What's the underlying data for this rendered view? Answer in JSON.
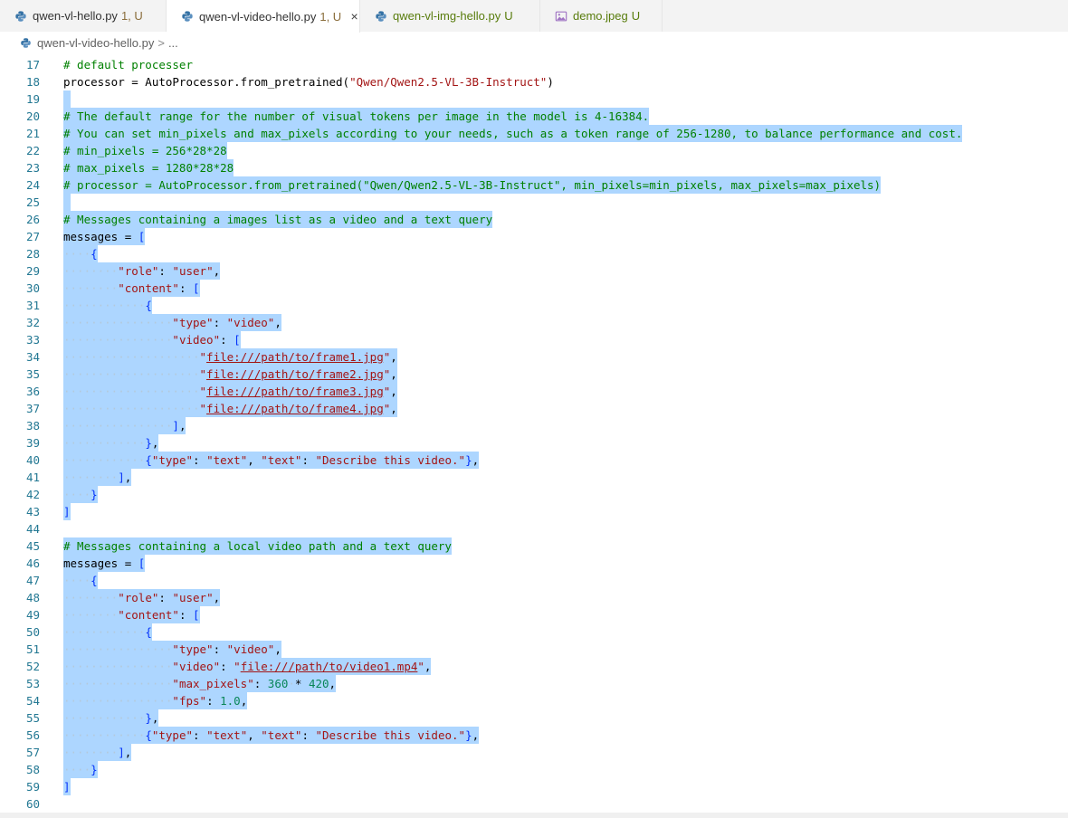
{
  "tabs": [
    {
      "name": "qwen-vl-hello.py",
      "badge": "1, U",
      "active": false,
      "kind": "python"
    },
    {
      "name": "qwen-vl-video-hello.py",
      "badge": "1, U",
      "active": true,
      "kind": "python",
      "close": "×"
    },
    {
      "name": "qwen-vl-img-hello.py",
      "badge": "U",
      "active": false,
      "kind": "python"
    },
    {
      "name": "demo.jpeg",
      "badge": "U",
      "active": false,
      "kind": "image"
    }
  ],
  "breadcrumb": {
    "file": "qwen-vl-video-hello.py",
    "separator": ">",
    "tail": "..."
  },
  "colors": {
    "comment": "#008000",
    "string": "#a31515",
    "number": "#098658",
    "bracket": "#0431fa",
    "selection": "#add6ff",
    "line_number": "#237893"
  },
  "lines": [
    {
      "n": "17",
      "sel": false,
      "segs": [
        [
          "c",
          "# default processer"
        ]
      ]
    },
    {
      "n": "18",
      "sel": false,
      "segs": [
        [
          "t",
          "processor = AutoProcessor.from_pretrained("
        ],
        [
          "s",
          "\"Qwen/Qwen2.5-VL-3B-Instruct\""
        ],
        [
          "t",
          ")"
        ]
      ]
    },
    {
      "n": "19",
      "sel": true,
      "segs": []
    },
    {
      "n": "20",
      "sel": true,
      "segs": [
        [
          "c",
          "# The default range for the number of visual tokens per image in the model is 4-16384."
        ]
      ]
    },
    {
      "n": "21",
      "sel": true,
      "segs": [
        [
          "c",
          "# You can set min_pixels and max_pixels according to your needs, such as a token range of 256-1280, to balance performance and cost."
        ]
      ]
    },
    {
      "n": "22",
      "sel": true,
      "segs": [
        [
          "c",
          "# min_pixels = 256*28*28"
        ]
      ]
    },
    {
      "n": "23",
      "sel": true,
      "segs": [
        [
          "c",
          "# max_pixels = 1280*28*28"
        ]
      ]
    },
    {
      "n": "24",
      "sel": true,
      "segs": [
        [
          "c",
          "# processor = AutoProcessor.from_pretrained(\"Qwen/Qwen2.5-VL-3B-Instruct\", min_pixels=min_pixels, max_pixels=max_pixels)"
        ]
      ]
    },
    {
      "n": "25",
      "sel": true,
      "segs": []
    },
    {
      "n": "26",
      "sel": true,
      "segs": [
        [
          "c",
          "# Messages containing a images list as a video and a text query"
        ]
      ]
    },
    {
      "n": "27",
      "sel": true,
      "segs": [
        [
          "t",
          "messages = "
        ],
        [
          "p",
          "["
        ]
      ]
    },
    {
      "n": "28",
      "sel": true,
      "segs": [
        [
          "t",
          "    "
        ],
        [
          "p",
          "{"
        ]
      ]
    },
    {
      "n": "29",
      "sel": true,
      "segs": [
        [
          "t",
          "        "
        ],
        [
          "s",
          "\"role\""
        ],
        [
          "t",
          ": "
        ],
        [
          "s",
          "\"user\""
        ],
        [
          "t",
          ","
        ]
      ]
    },
    {
      "n": "30",
      "sel": true,
      "segs": [
        [
          "t",
          "        "
        ],
        [
          "s",
          "\"content\""
        ],
        [
          "t",
          ": "
        ],
        [
          "p",
          "["
        ]
      ]
    },
    {
      "n": "31",
      "sel": true,
      "segs": [
        [
          "t",
          "            "
        ],
        [
          "p",
          "{"
        ]
      ]
    },
    {
      "n": "32",
      "sel": true,
      "segs": [
        [
          "t",
          "                "
        ],
        [
          "s",
          "\"type\""
        ],
        [
          "t",
          ": "
        ],
        [
          "s",
          "\"video\""
        ],
        [
          "t",
          ","
        ]
      ]
    },
    {
      "n": "33",
      "sel": true,
      "segs": [
        [
          "t",
          "                "
        ],
        [
          "s",
          "\"video\""
        ],
        [
          "t",
          ": "
        ],
        [
          "p",
          "["
        ]
      ]
    },
    {
      "n": "34",
      "sel": true,
      "segs": [
        [
          "t",
          "                    "
        ],
        [
          "s",
          "\""
        ],
        [
          "su",
          "file:///path/to/frame1.jpg"
        ],
        [
          "s",
          "\""
        ],
        [
          "t",
          ","
        ]
      ]
    },
    {
      "n": "35",
      "sel": true,
      "segs": [
        [
          "t",
          "                    "
        ],
        [
          "s",
          "\""
        ],
        [
          "su",
          "file:///path/to/frame2.jpg"
        ],
        [
          "s",
          "\""
        ],
        [
          "t",
          ","
        ]
      ]
    },
    {
      "n": "36",
      "sel": true,
      "segs": [
        [
          "t",
          "                    "
        ],
        [
          "s",
          "\""
        ],
        [
          "su",
          "file:///path/to/frame3.jpg"
        ],
        [
          "s",
          "\""
        ],
        [
          "t",
          ","
        ]
      ]
    },
    {
      "n": "37",
      "sel": true,
      "segs": [
        [
          "t",
          "                    "
        ],
        [
          "s",
          "\""
        ],
        [
          "su",
          "file:///path/to/frame4.jpg"
        ],
        [
          "s",
          "\""
        ],
        [
          "t",
          ","
        ]
      ]
    },
    {
      "n": "38",
      "sel": true,
      "segs": [
        [
          "t",
          "                "
        ],
        [
          "p",
          "]"
        ],
        [
          "t",
          ","
        ]
      ]
    },
    {
      "n": "39",
      "sel": true,
      "segs": [
        [
          "t",
          "            "
        ],
        [
          "p",
          "}"
        ],
        [
          "t",
          ","
        ]
      ]
    },
    {
      "n": "40",
      "sel": true,
      "segs": [
        [
          "t",
          "            "
        ],
        [
          "p",
          "{"
        ],
        [
          "s",
          "\"type\""
        ],
        [
          "t",
          ": "
        ],
        [
          "s",
          "\"text\""
        ],
        [
          "t",
          ", "
        ],
        [
          "s",
          "\"text\""
        ],
        [
          "t",
          ": "
        ],
        [
          "s",
          "\"Describe this video.\""
        ],
        [
          "p",
          "}"
        ],
        [
          "t",
          ","
        ]
      ]
    },
    {
      "n": "41",
      "sel": true,
      "segs": [
        [
          "t",
          "        "
        ],
        [
          "p",
          "]"
        ],
        [
          "t",
          ","
        ]
      ]
    },
    {
      "n": "42",
      "sel": true,
      "segs": [
        [
          "t",
          "    "
        ],
        [
          "p",
          "}"
        ]
      ]
    },
    {
      "n": "43",
      "sel": true,
      "segs": [
        [
          "p",
          "]"
        ]
      ]
    },
    {
      "n": "44",
      "sel": false,
      "segs": []
    },
    {
      "n": "45",
      "sel": true,
      "segs": [
        [
          "c",
          "# Messages containing a local video path and a text query"
        ]
      ]
    },
    {
      "n": "46",
      "sel": true,
      "segs": [
        [
          "t",
          "messages = "
        ],
        [
          "p",
          "["
        ]
      ]
    },
    {
      "n": "47",
      "sel": true,
      "segs": [
        [
          "t",
          "    "
        ],
        [
          "p",
          "{"
        ]
      ]
    },
    {
      "n": "48",
      "sel": true,
      "segs": [
        [
          "t",
          "        "
        ],
        [
          "s",
          "\"role\""
        ],
        [
          "t",
          ": "
        ],
        [
          "s",
          "\"user\""
        ],
        [
          "t",
          ","
        ]
      ]
    },
    {
      "n": "49",
      "sel": true,
      "segs": [
        [
          "t",
          "        "
        ],
        [
          "s",
          "\"content\""
        ],
        [
          "t",
          ": "
        ],
        [
          "p",
          "["
        ]
      ]
    },
    {
      "n": "50",
      "sel": true,
      "segs": [
        [
          "t",
          "            "
        ],
        [
          "p",
          "{"
        ]
      ]
    },
    {
      "n": "51",
      "sel": true,
      "segs": [
        [
          "t",
          "                "
        ],
        [
          "s",
          "\"type\""
        ],
        [
          "t",
          ": "
        ],
        [
          "s",
          "\"video\""
        ],
        [
          "t",
          ","
        ]
      ]
    },
    {
      "n": "52",
      "sel": true,
      "segs": [
        [
          "t",
          "                "
        ],
        [
          "s",
          "\"video\""
        ],
        [
          "t",
          ": "
        ],
        [
          "s",
          "\""
        ],
        [
          "su",
          "file:///path/to/video1.mp4"
        ],
        [
          "s",
          "\""
        ],
        [
          "t",
          ","
        ]
      ]
    },
    {
      "n": "53",
      "sel": true,
      "segs": [
        [
          "t",
          "                "
        ],
        [
          "s",
          "\"max_pixels\""
        ],
        [
          "t",
          ": "
        ],
        [
          "n",
          "360"
        ],
        [
          "t",
          " * "
        ],
        [
          "n",
          "420"
        ],
        [
          "t",
          ","
        ]
      ]
    },
    {
      "n": "54",
      "sel": true,
      "segs": [
        [
          "t",
          "                "
        ],
        [
          "s",
          "\"fps\""
        ],
        [
          "t",
          ": "
        ],
        [
          "n",
          "1.0"
        ],
        [
          "t",
          ","
        ]
      ]
    },
    {
      "n": "55",
      "sel": true,
      "segs": [
        [
          "t",
          "            "
        ],
        [
          "p",
          "}"
        ],
        [
          "t",
          ","
        ]
      ]
    },
    {
      "n": "56",
      "sel": true,
      "segs": [
        [
          "t",
          "            "
        ],
        [
          "p",
          "{"
        ],
        [
          "s",
          "\"type\""
        ],
        [
          "t",
          ": "
        ],
        [
          "s",
          "\"text\""
        ],
        [
          "t",
          ", "
        ],
        [
          "s",
          "\"text\""
        ],
        [
          "t",
          ": "
        ],
        [
          "s",
          "\"Describe this video.\""
        ],
        [
          "p",
          "}"
        ],
        [
          "t",
          ","
        ]
      ]
    },
    {
      "n": "57",
      "sel": true,
      "segs": [
        [
          "t",
          "        "
        ],
        [
          "p",
          "]"
        ],
        [
          "t",
          ","
        ]
      ]
    },
    {
      "n": "58",
      "sel": true,
      "segs": [
        [
          "t",
          "    "
        ],
        [
          "p",
          "}"
        ]
      ]
    },
    {
      "n": "59",
      "sel": true,
      "segs": [
        [
          "p",
          "]"
        ]
      ]
    },
    {
      "n": "60",
      "sel": false,
      "segs": []
    }
  ]
}
